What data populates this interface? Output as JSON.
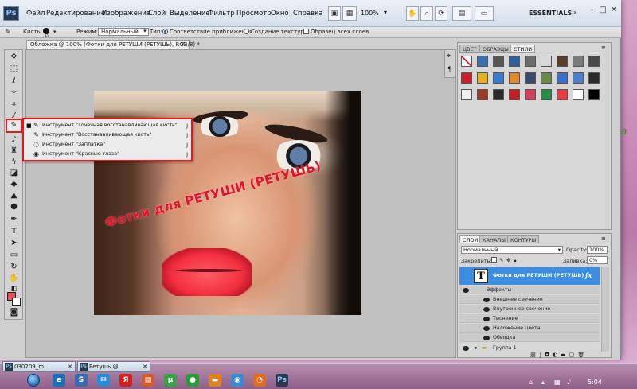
{
  "app": {
    "logo": "Ps",
    "menu": [
      "Файл",
      "Редактирование",
      "Изображение",
      "Слой",
      "Выделение",
      "Фильтр",
      "Просмотр",
      "Окно",
      "Справка"
    ],
    "zoom": "100%",
    "workspace": "ESSENTIALS"
  },
  "options_bar": {
    "brush_label": "Кисть:",
    "brush_size": "19",
    "mode_label": "Режим:",
    "mode_value": "Нормальный",
    "type_label": "Тип:",
    "type_option_1": "Соответствие приближения",
    "type_option_2": "Создание текстуры",
    "sample_all": "Образец всех слоев"
  },
  "document": {
    "tab_title": "Обложка @ 100% (Фотки для РЕТУШИ (РЕТУШЬ), RGB/8) *",
    "overlay_text": "Фотки для РЕТУШИ (РЕТУШЬ)"
  },
  "flyout": {
    "items": [
      {
        "label": "Инструмент \"Точечная восстанавливающая кисть\"",
        "key": "J",
        "active": true
      },
      {
        "label": "Инструмент \"Восстанавливающая кисть\"",
        "key": "J",
        "active": false
      },
      {
        "label": "Инструмент \"Заплатка\"",
        "key": "J",
        "active": false
      },
      {
        "label": "Инструмент \"Красные глаза\"",
        "key": "J",
        "active": false
      }
    ]
  },
  "styles_panel": {
    "tabs": [
      "ЦВЕТ",
      "ОБРАЗЦЫ",
      "СТИЛИ"
    ],
    "active_tab": "СТИЛИ",
    "swatch_colors": [
      "#ffffff",
      "#3a6fb0",
      "#555555",
      "#2f5f9a",
      "#6c6c6c",
      "#d8d8d8",
      "#5a3c28",
      "#7a7a7a",
      "#4a4a4a",
      "#c8202a",
      "#e0b020",
      "#3a7acc",
      "#e08a30",
      "#3a4a6a",
      "#6a8a4a",
      "#3a70c8",
      "#4a80d0",
      "#2a2a2a",
      "#f0f0f0",
      "#9a3a2a",
      "#2a2a2a",
      "#c02020",
      "#d04060",
      "#2a8a4a",
      "#e04040",
      "#ffffff",
      "#000000"
    ]
  },
  "layers_panel": {
    "tabs": [
      "СЛОИ",
      "КАНАЛЫ",
      "КОНТУРЫ"
    ],
    "active_tab": "СЛОИ",
    "blend_mode": "Нормальный",
    "opacity_label": "Opacity:",
    "opacity": "100%",
    "lock_label": "Закрепить:",
    "fill_label": "Заливка:",
    "fill": "0%",
    "selected_layer": "Фотки для РЕТУШИ (РЕТУШЬ)",
    "effects_label": "Эффекты",
    "effects": [
      "Внешнее свечение",
      "Внутреннее свечение",
      "Тиснение",
      "Наложение цвета",
      "Обводка"
    ],
    "group_layer": "Группа 1"
  },
  "taskbar": {
    "window_1": "030209_m...",
    "window_2": "Ретушь @ ...",
    "clock": "5:04"
  }
}
